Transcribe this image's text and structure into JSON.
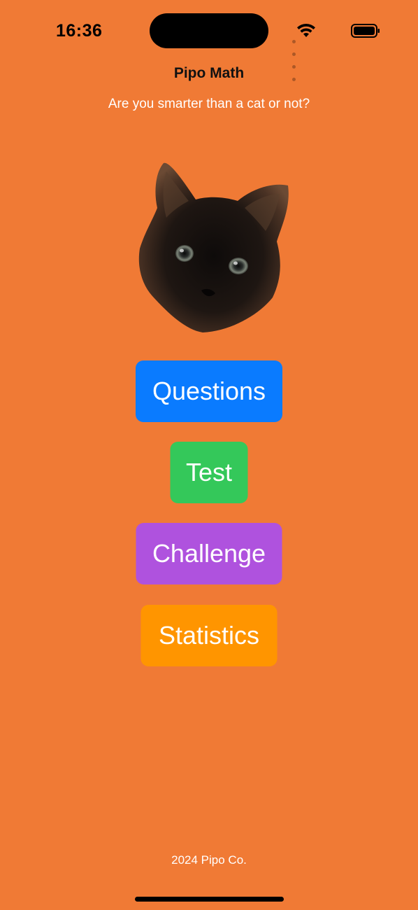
{
  "status_bar": {
    "time": "16:36",
    "icons": [
      "signal-dots-icon",
      "wifi-icon",
      "battery-icon"
    ]
  },
  "header": {
    "title": "Pipo Math",
    "subtitle": "Are you smarter than a cat or not?"
  },
  "hero": {
    "image": "cat-face-image"
  },
  "menu": {
    "questions_label": "Questions",
    "test_label": "Test",
    "challenge_label": "Challenge",
    "statistics_label": "Statistics"
  },
  "footer": {
    "text": "2024 Pipo Co."
  },
  "colors": {
    "background": "#F07A35",
    "questions": "#0A7BFF",
    "test": "#34C85A",
    "challenge": "#AF52DE",
    "statistics": "#FF9500"
  }
}
